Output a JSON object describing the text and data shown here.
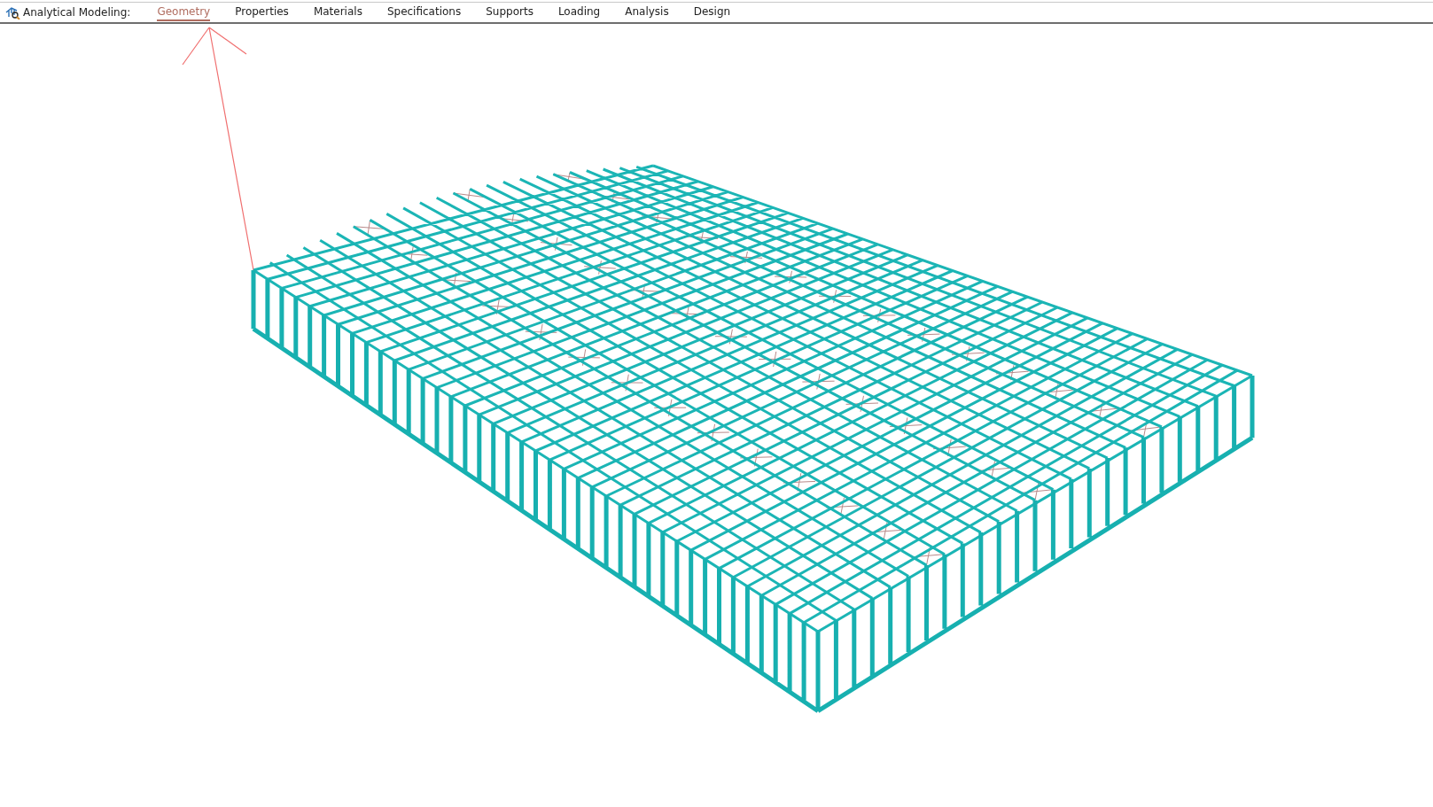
{
  "toolbar": {
    "label": "Analytical Modeling:",
    "tabs": [
      {
        "label": "Geometry",
        "selected": true
      },
      {
        "label": "Properties",
        "selected": false
      },
      {
        "label": "Materials",
        "selected": false
      },
      {
        "label": "Specifications",
        "selected": false
      },
      {
        "label": "Supports",
        "selected": false
      },
      {
        "label": "Loading",
        "selected": false
      },
      {
        "label": "Analysis",
        "selected": false
      },
      {
        "label": "Design",
        "selected": false
      }
    ]
  }
}
